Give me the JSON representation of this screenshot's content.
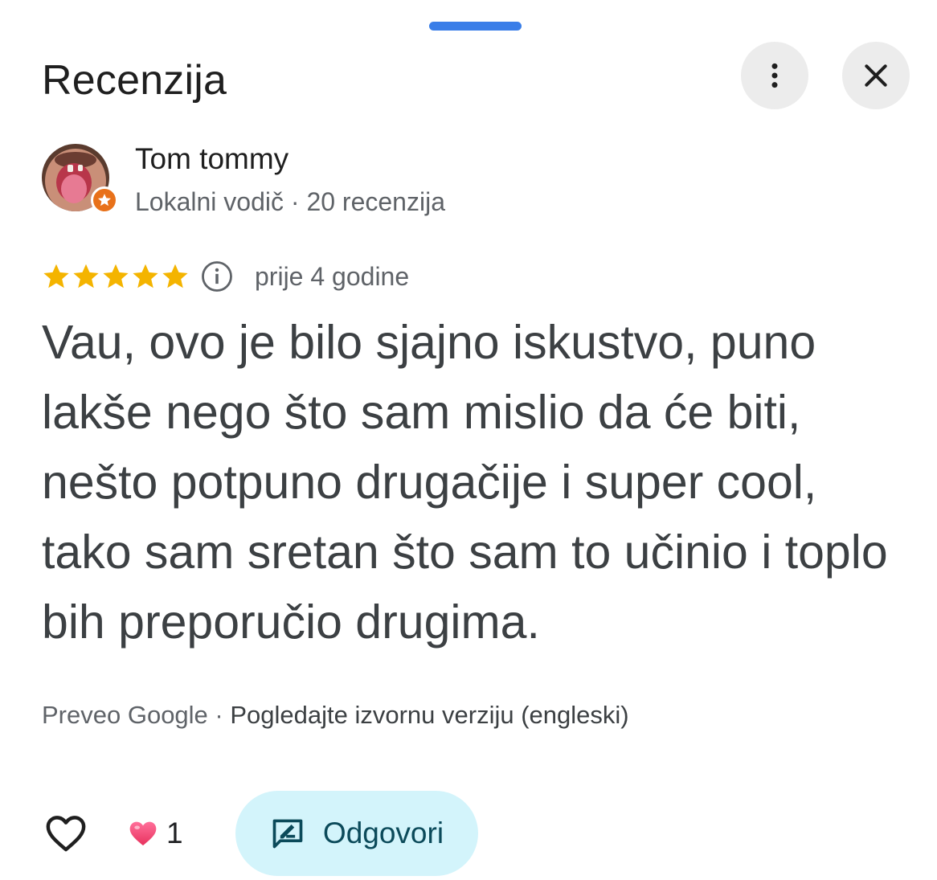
{
  "sheet": {
    "title": "Recenzija",
    "more_icon": "more-vert-icon",
    "close_icon": "close-icon"
  },
  "author": {
    "name": "Tom tommy",
    "meta": "Lokalni vodič · 20 recenzija",
    "badge_icon": "local-guide-star-icon"
  },
  "review": {
    "rating": 5,
    "rating_max": 5,
    "star_color": "#f4b400",
    "time": "prije 4 godine",
    "text": "Vau, ovo je bilo sjajno iskustvo, puno lakše nego što sam mislio da će biti, nešto potpuno drugačije i super cool, tako sam sretan što sam to učinio i toplo bih preporučio drugima."
  },
  "translation": {
    "prefix": "Preveo Google · ",
    "link": "Pogledajte izvornu verziju (engleski)"
  },
  "actions": {
    "like_icon": "heart-outline-icon",
    "reaction_icon": "pink-heart-icon",
    "reaction_count": "1",
    "reply_icon": "reply-icon",
    "reply_label": "Odgovori"
  },
  "colors": {
    "handle": "#3a7ee8",
    "badge": "#e8711a",
    "reply_bg": "#d3f4fb",
    "reply_text": "#0b4a5a"
  }
}
